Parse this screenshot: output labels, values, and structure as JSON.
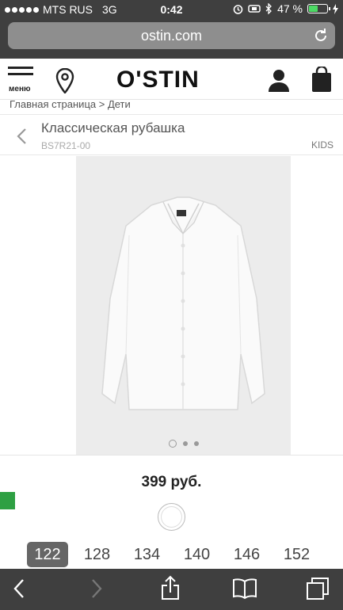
{
  "status_bar": {
    "carrier": "MTS RUS",
    "network": "3G",
    "time": "0:42",
    "battery_percent": "47 %",
    "battery_level": 0.47,
    "battery_color": "#4cd964"
  },
  "browser": {
    "url": "ostin.com"
  },
  "header": {
    "menu_label": "меню",
    "logo": "O'STIN"
  },
  "breadcrumb": "Главная страница > Дети",
  "product": {
    "title": "Классическая рубашка",
    "sku": "BS7R21-00",
    "tag": "KIDS",
    "price": "399 руб.",
    "image_count": 3,
    "sizes": [
      "122",
      "128",
      "134",
      "140",
      "146",
      "152"
    ],
    "selected_size": "122"
  },
  "colors": {
    "accent_green": "#2ea043",
    "logo_red": "#e30613",
    "browser_chrome": "#3f3f3f"
  }
}
